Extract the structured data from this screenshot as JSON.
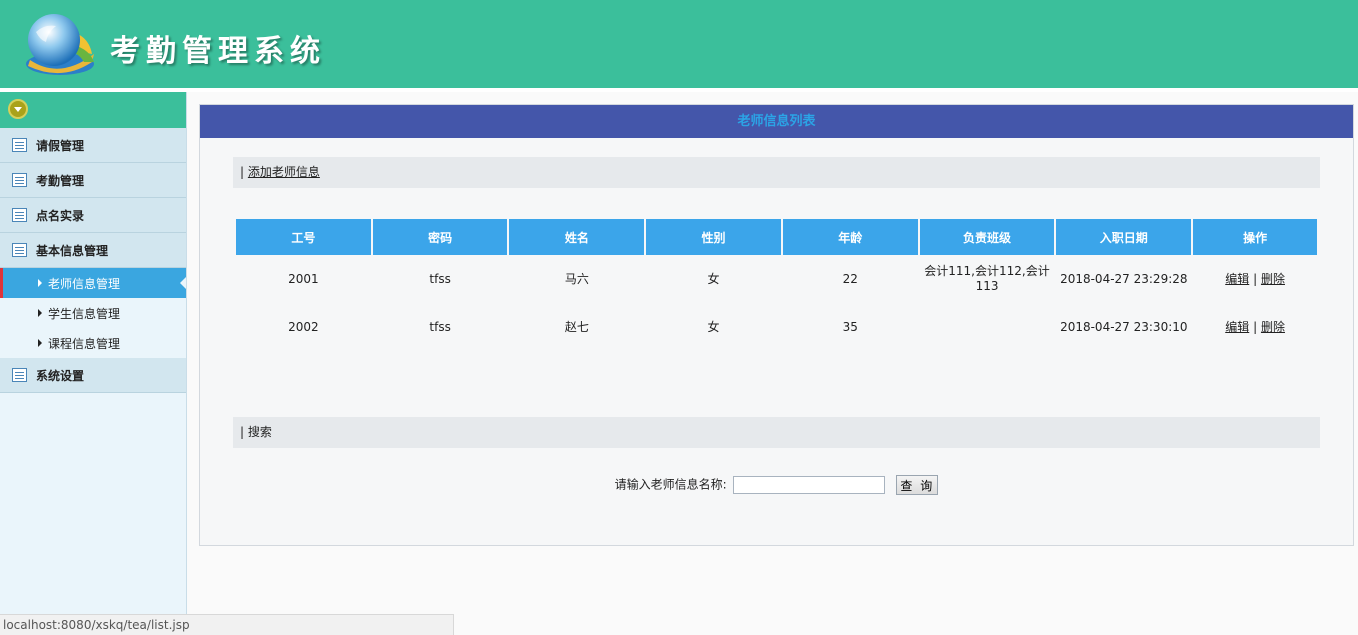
{
  "app": {
    "title": "考勤管理系统",
    "logo_icon": "globe-logo"
  },
  "colors": {
    "header": "#3bbf9b",
    "panel_header": "#4456aa",
    "table_header": "#3ba5ea",
    "active_menu": "#3aa6e0"
  },
  "sidebar": {
    "menus": [
      {
        "label": "请假管理"
      },
      {
        "label": "考勤管理"
      },
      {
        "label": "点名实录"
      },
      {
        "label": "基本信息管理"
      }
    ],
    "submenus": [
      {
        "label": "老师信息管理"
      },
      {
        "label": "学生信息管理"
      },
      {
        "label": "课程信息管理"
      }
    ],
    "bottom_menu": {
      "label": "系统设置"
    }
  },
  "panel": {
    "title": "老师信息列表",
    "add_bar": {
      "prefix": "|",
      "link": "添加老师信息"
    },
    "table": {
      "headers": [
        "工号",
        "密码",
        "姓名",
        "性别",
        "年龄",
        "负责班级",
        "入职日期",
        "操作"
      ],
      "rows": [
        {
          "id": "2001",
          "password": "tfss",
          "name": "马六",
          "gender": "女",
          "age": "22",
          "classes": "会计111,会计112,会计113",
          "date": "2018-04-27 23:29:28",
          "edit": "编辑",
          "sep": "|",
          "delete": "删除"
        },
        {
          "id": "2002",
          "password": "tfss",
          "name": "赵七",
          "gender": "女",
          "age": "35",
          "classes": "",
          "date": "2018-04-27 23:30:10",
          "edit": "编辑",
          "sep": "|",
          "delete": "删除"
        }
      ]
    },
    "search_bar": {
      "prefix": "|",
      "label": "搜索"
    },
    "search": {
      "label": "请输入老师信息名称:",
      "value": "",
      "button": "查 询"
    }
  },
  "status_bar": {
    "url": "localhost:8080/xskq/tea/list.jsp"
  }
}
